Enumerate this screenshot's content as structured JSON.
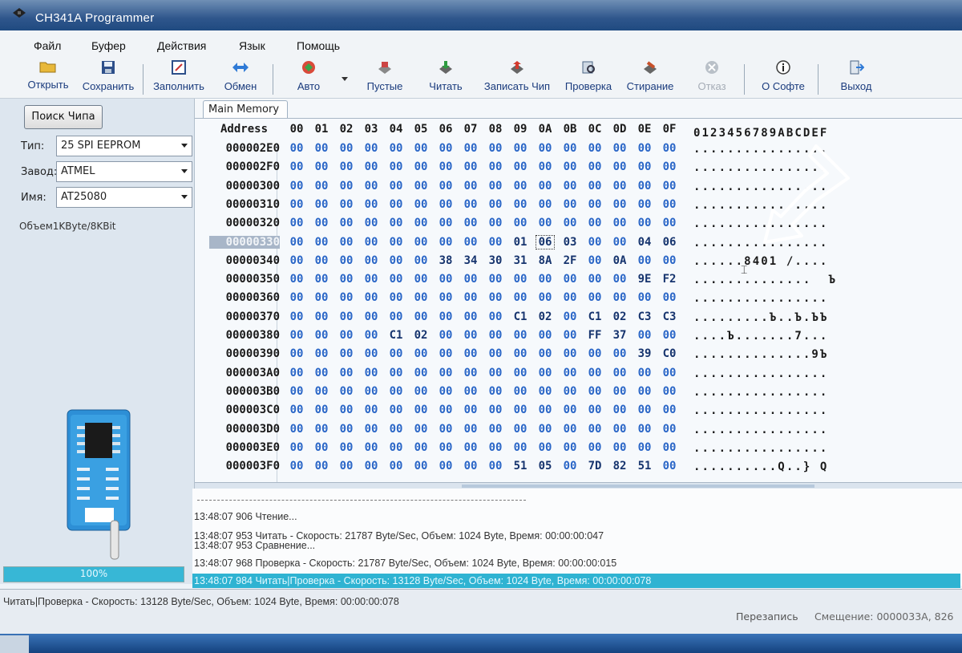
{
  "window": {
    "title": "CH341A Programmer"
  },
  "menu": [
    "Файл",
    "Буфер",
    "Действия",
    "Язык",
    "Помощь"
  ],
  "toolbar": [
    {
      "label": "Открыть",
      "icon": "folder-icon"
    },
    {
      "label": "Сохранить",
      "icon": "save-icon"
    },
    {
      "label": "Заполнить",
      "icon": "fill-icon"
    },
    {
      "label": "Обмен",
      "icon": "swap-icon"
    },
    {
      "label": "Авто",
      "icon": "auto-icon"
    },
    {
      "label": "Пустые",
      "icon": "blank-check-icon"
    },
    {
      "label": "Читать",
      "icon": "read-icon"
    },
    {
      "label": "Записать Чип",
      "icon": "write-icon"
    },
    {
      "label": "Проверка",
      "icon": "verify-icon"
    },
    {
      "label": "Стирание",
      "icon": "erase-icon"
    },
    {
      "label": "Отказ",
      "icon": "cancel-icon",
      "disabled": true
    },
    {
      "label": "О Софте",
      "icon": "info-icon"
    },
    {
      "label": "Выход",
      "icon": "exit-icon"
    }
  ],
  "left": {
    "search_button": "Поиск Чипа",
    "type_label": "Тип:",
    "type_value": "25 SPI EEPROM",
    "vendor_label": "Завод:",
    "vendor_value": "ATMEL",
    "name_label": "Имя:",
    "name_value": "AT25080",
    "volume": "Объем1KByte/8KBit",
    "progress_text": "100%",
    "progress_fraction": 1.0
  },
  "hex": {
    "tab": "Main Memory",
    "address_header": "Address",
    "columns": [
      "00",
      "01",
      "02",
      "03",
      "04",
      "05",
      "06",
      "07",
      "08",
      "09",
      "0A",
      "0B",
      "0C",
      "0D",
      "0E",
      "0F"
    ],
    "ascii_header": "0123456789ABCDEF",
    "selected_address": "00000330",
    "rows": [
      {
        "addr": "000002E0",
        "bytes": [
          "00",
          "00",
          "00",
          "00",
          "00",
          "00",
          "00",
          "00",
          "00",
          "00",
          "00",
          "00",
          "00",
          "00",
          "00",
          "00"
        ],
        "ascii": "................"
      },
      {
        "addr": "000002F0",
        "bytes": [
          "00",
          "00",
          "00",
          "00",
          "00",
          "00",
          "00",
          "00",
          "00",
          "00",
          "00",
          "00",
          "00",
          "00",
          "00",
          "00"
        ],
        "ascii": "................"
      },
      {
        "addr": "00000300",
        "bytes": [
          "00",
          "00",
          "00",
          "00",
          "00",
          "00",
          "00",
          "00",
          "00",
          "00",
          "00",
          "00",
          "00",
          "00",
          "00",
          "00"
        ],
        "ascii": "................"
      },
      {
        "addr": "00000310",
        "bytes": [
          "00",
          "00",
          "00",
          "00",
          "00",
          "00",
          "00",
          "00",
          "00",
          "00",
          "00",
          "00",
          "00",
          "00",
          "00",
          "00"
        ],
        "ascii": "................"
      },
      {
        "addr": "00000320",
        "bytes": [
          "00",
          "00",
          "00",
          "00",
          "00",
          "00",
          "00",
          "00",
          "00",
          "00",
          "00",
          "00",
          "00",
          "00",
          "00",
          "00"
        ],
        "ascii": "................"
      },
      {
        "addr": "00000330",
        "bytes": [
          "00",
          "00",
          "00",
          "00",
          "00",
          "00",
          "00",
          "00",
          "00",
          "01",
          "06",
          "03",
          "00",
          "00",
          "04",
          "06"
        ],
        "ascii": "................"
      },
      {
        "addr": "00000340",
        "bytes": [
          "00",
          "00",
          "00",
          "00",
          "00",
          "00",
          "38",
          "34",
          "30",
          "31",
          "8A",
          "2F",
          "00",
          "0A",
          "00",
          "00"
        ],
        "ascii": "......8401 /...."
      },
      {
        "addr": "00000350",
        "bytes": [
          "00",
          "00",
          "00",
          "00",
          "00",
          "00",
          "00",
          "00",
          "00",
          "00",
          "00",
          "00",
          "00",
          "00",
          "9E",
          "F2"
        ],
        "ascii": "..............  Ъ"
      },
      {
        "addr": "00000360",
        "bytes": [
          "00",
          "00",
          "00",
          "00",
          "00",
          "00",
          "00",
          "00",
          "00",
          "00",
          "00",
          "00",
          "00",
          "00",
          "00",
          "00"
        ],
        "ascii": "................"
      },
      {
        "addr": "00000370",
        "bytes": [
          "00",
          "00",
          "00",
          "00",
          "00",
          "00",
          "00",
          "00",
          "00",
          "C1",
          "02",
          "00",
          "C1",
          "02",
          "C3",
          "C3"
        ],
        "ascii": ".........Ъ..Ъ.ЪЪ"
      },
      {
        "addr": "00000380",
        "bytes": [
          "00",
          "00",
          "00",
          "00",
          "C1",
          "02",
          "00",
          "00",
          "00",
          "00",
          "00",
          "00",
          "FF",
          "37",
          "00",
          "00"
        ],
        "ascii": "....Ъ.......7..."
      },
      {
        "addr": "00000390",
        "bytes": [
          "00",
          "00",
          "00",
          "00",
          "00",
          "00",
          "00",
          "00",
          "00",
          "00",
          "00",
          "00",
          "00",
          "00",
          "39",
          "C0"
        ],
        "ascii": "..............9Ъ"
      },
      {
        "addr": "000003A0",
        "bytes": [
          "00",
          "00",
          "00",
          "00",
          "00",
          "00",
          "00",
          "00",
          "00",
          "00",
          "00",
          "00",
          "00",
          "00",
          "00",
          "00"
        ],
        "ascii": "................"
      },
      {
        "addr": "000003B0",
        "bytes": [
          "00",
          "00",
          "00",
          "00",
          "00",
          "00",
          "00",
          "00",
          "00",
          "00",
          "00",
          "00",
          "00",
          "00",
          "00",
          "00"
        ],
        "ascii": "................"
      },
      {
        "addr": "000003C0",
        "bytes": [
          "00",
          "00",
          "00",
          "00",
          "00",
          "00",
          "00",
          "00",
          "00",
          "00",
          "00",
          "00",
          "00",
          "00",
          "00",
          "00"
        ],
        "ascii": "................"
      },
      {
        "addr": "000003D0",
        "bytes": [
          "00",
          "00",
          "00",
          "00",
          "00",
          "00",
          "00",
          "00",
          "00",
          "00",
          "00",
          "00",
          "00",
          "00",
          "00",
          "00"
        ],
        "ascii": "................"
      },
      {
        "addr": "000003E0",
        "bytes": [
          "00",
          "00",
          "00",
          "00",
          "00",
          "00",
          "00",
          "00",
          "00",
          "00",
          "00",
          "00",
          "00",
          "00",
          "00",
          "00"
        ],
        "ascii": "................"
      },
      {
        "addr": "000003F0",
        "bytes": [
          "00",
          "00",
          "00",
          "00",
          "00",
          "00",
          "00",
          "00",
          "00",
          "51",
          "05",
          "00",
          "7D",
          "82",
          "51",
          "00"
        ],
        "ascii": "..........Q..} Q"
      }
    ]
  },
  "log": [
    "13:48:07 906 Чтение...",
    "13:48:07 953 Читать - Скорость: 21787 Byte/Sec, Объем: 1024 Byte, Время: 00:00:00:047",
    "13:48:07 953 Сравнение...",
    "13:48:07 968 Проверка - Скорость: 21787 Byte/Sec, Объем: 1024 Byte, Время: 00:00:00:015",
    "13:48:07 984 Читать|Проверка - Скорость: 13128 Byte/Sec, Объем: 1024 Byte, Время: 00:00:00:078"
  ],
  "status": {
    "text": "Читать|Проверка - Скорость: 13128 Byte/Sec, Объем: 1024 Byte, Время: 00:00:00:078",
    "mode": "Перезапись",
    "offset": "Смещение: 0000033A, 826"
  },
  "colors": {
    "byte_zero": "#2a66c7",
    "byte_value": "#16346e",
    "log_highlight": "#2fb3d2",
    "progress": "#37b7d6"
  }
}
